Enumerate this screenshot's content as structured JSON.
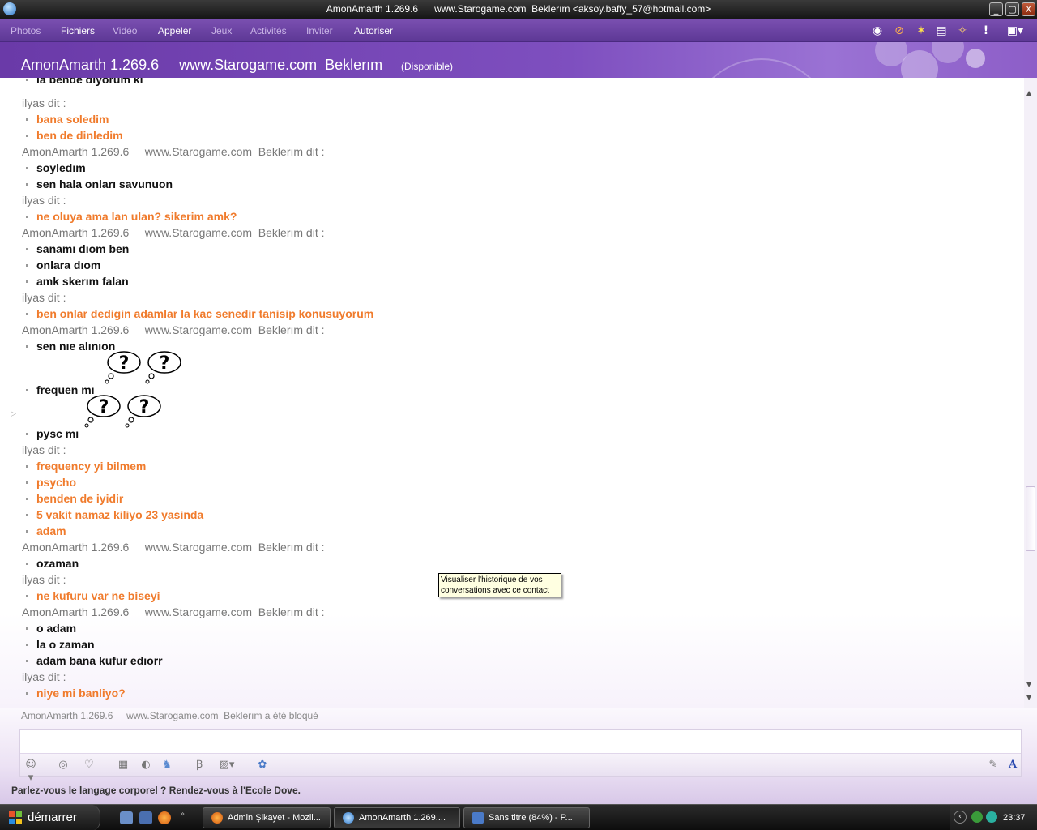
{
  "window": {
    "title": "AmonAmarth 1.269.6      www.Starogame.com  Beklerım <aksoy.baffy_57@hotmail.com>",
    "controls": [
      "_",
      "▢",
      "X"
    ]
  },
  "menubar": {
    "items": [
      {
        "label": "Photos",
        "enabled": false
      },
      {
        "label": "Fichiers",
        "enabled": true
      },
      {
        "label": "Vidéo",
        "enabled": false
      },
      {
        "label": "Appeler",
        "enabled": true
      },
      {
        "label": "Jeux",
        "enabled": false
      },
      {
        "label": "Activités",
        "enabled": false
      },
      {
        "label": "Inviter",
        "enabled": false
      },
      {
        "label": "Autoriser",
        "enabled": true
      }
    ],
    "toolbar_icons": [
      "webcam-icon",
      "block-icon",
      "wink-icon",
      "document-icon",
      "nudge-icon",
      "alert-icon",
      "menu-icon"
    ]
  },
  "header": {
    "contact_name": "AmonAmarth 1.269.6     www.Starogame.com  Beklerım",
    "status": "(Disponible)"
  },
  "chat": {
    "messages": [
      {
        "kind": "line",
        "who": "me",
        "text": "la bende dıyorum kı"
      },
      {
        "kind": "header",
        "text": "ilyas dit :"
      },
      {
        "kind": "line",
        "who": "them",
        "text": "bana soledim"
      },
      {
        "kind": "line",
        "who": "them",
        "text": "ben de dinledim"
      },
      {
        "kind": "header",
        "text": "AmonAmarth 1.269.6     www.Starogame.com  Beklerım dit :"
      },
      {
        "kind": "line",
        "who": "me",
        "text": "soyledım"
      },
      {
        "kind": "line",
        "who": "me",
        "text": "sen hala onları savunuon"
      },
      {
        "kind": "header",
        "text": "ilyas dit :"
      },
      {
        "kind": "line",
        "who": "them",
        "text": "ne oluya ama lan ulan? sikerim amk?"
      },
      {
        "kind": "header",
        "text": "AmonAmarth 1.269.6     www.Starogame.com  Beklerım dit :"
      },
      {
        "kind": "line",
        "who": "me",
        "text": "sanamı dıom ben"
      },
      {
        "kind": "line",
        "who": "me",
        "text": "onlara dıom"
      },
      {
        "kind": "line",
        "who": "me",
        "text": "amk skerım falan"
      },
      {
        "kind": "header",
        "text": "ilyas dit :"
      },
      {
        "kind": "line",
        "who": "them",
        "text": "ben onlar dedigin adamlar la kac senedir tanisip konusuyorum"
      },
      {
        "kind": "header",
        "text": "AmonAmarth 1.269.6     www.Starogame.com  Beklerım dit :"
      },
      {
        "kind": "line",
        "who": "me",
        "text": "sen nıe alınıon"
      },
      {
        "kind": "line",
        "who": "me",
        "text": "frequen mı",
        "emoticons": 2
      },
      {
        "kind": "line",
        "who": "me",
        "text": "pysc mı",
        "emoticons": 2
      },
      {
        "kind": "header",
        "text": "ilyas dit :"
      },
      {
        "kind": "line",
        "who": "them",
        "text": "frequency yi bilmem"
      },
      {
        "kind": "line",
        "who": "them",
        "text": "psycho"
      },
      {
        "kind": "line",
        "who": "them",
        "text": "benden de iyidir"
      },
      {
        "kind": "line",
        "who": "them",
        "text": "5 vakit namaz kiliyo 23 yasinda"
      },
      {
        "kind": "line",
        "who": "them",
        "text": "adam"
      },
      {
        "kind": "header",
        "text": "AmonAmarth 1.269.6     www.Starogame.com  Beklerım dit :"
      },
      {
        "kind": "line",
        "who": "me",
        "text": "ozaman"
      },
      {
        "kind": "header",
        "text": "ilyas dit :"
      },
      {
        "kind": "line",
        "who": "them",
        "text": "ne kufuru var ne biseyi"
      },
      {
        "kind": "header",
        "text": "AmonAmarth 1.269.6     www.Starogame.com  Beklerım dit :"
      },
      {
        "kind": "line",
        "who": "me",
        "text": "o adam"
      },
      {
        "kind": "line",
        "who": "me",
        "text": "la o zaman"
      },
      {
        "kind": "line",
        "who": "me",
        "text": "adam bana kufur edıorr"
      },
      {
        "kind": "header",
        "text": "ilyas dit :"
      },
      {
        "kind": "line",
        "who": "them",
        "text": "niye mi banliyo?"
      }
    ],
    "blocked_notice": "AmonAmarth 1.269.6     www.Starogame.com  Beklerım a été bloqué"
  },
  "tooltip": {
    "text_line1": "Visualiser l'historique de vos",
    "text_line2": "conversations avec ce contact"
  },
  "input": {
    "value": "",
    "toolbar_icons": [
      "emoticon-icon",
      "voice-clip-icon",
      "wink-icon",
      "background-icon",
      "gift-icon",
      "game-icon",
      "font-icon",
      "handwriting-icon",
      "history-icon",
      "pen-icon",
      "text-format-icon"
    ]
  },
  "ad": {
    "text": "Parlez-vous le langage corporel ? Rendez-vous à l'Ecole Dove."
  },
  "taskbar": {
    "start_label": "démarrer",
    "buttons": [
      {
        "label": "Admin Şikayet - Mozil...",
        "active": false
      },
      {
        "label": "AmonAmarth 1.269....",
        "active": true
      },
      {
        "label": "Sans titre (84%) - P...",
        "active": false
      }
    ],
    "clock": "23:37"
  },
  "colors": {
    "accent_purple": "#6a3aa8",
    "their_text": "#f07b2c",
    "my_text": "#111111"
  }
}
